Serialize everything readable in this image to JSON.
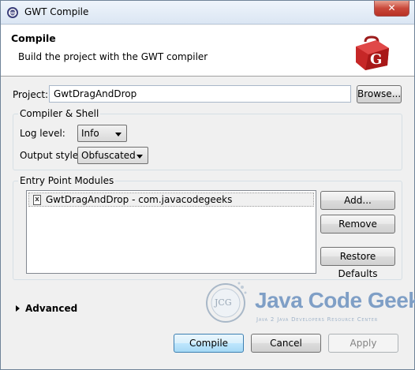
{
  "window": {
    "title": "GWT Compile",
    "close_label": "✕"
  },
  "header": {
    "title": "Compile",
    "description": "Build the project with the GWT compiler"
  },
  "project": {
    "label": "Project:",
    "value": "GwtDragAndDrop",
    "browse_label": "Browse..."
  },
  "compiler_shell": {
    "group_label": "Compiler & Shell",
    "log_level_label": "Log level:",
    "log_level_value": "Info",
    "output_style_label": "Output style:",
    "output_style_value": "Obfuscated"
  },
  "entry_points": {
    "group_label": "Entry Point Modules",
    "items": [
      {
        "label": "GwtDragAndDrop - com.javacodegeeks"
      }
    ],
    "add_label": "Add...",
    "remove_label": "Remove",
    "restore_label": "Restore Defaults"
  },
  "advanced": {
    "label": "Advanced"
  },
  "watermark": {
    "badge": "JCG",
    "brand": "Java Code Geeks",
    "tagline": "Java 2 Java Developers Resource Center"
  },
  "footer": {
    "compile_label": "Compile",
    "cancel_label": "Cancel",
    "apply_label": "Apply"
  },
  "colors": {
    "title_gradient_top": "#eef4fb",
    "close_red": "#c9483a",
    "gwt_red": "#d42a2a",
    "watermark_blue": "#7f9fc6"
  }
}
